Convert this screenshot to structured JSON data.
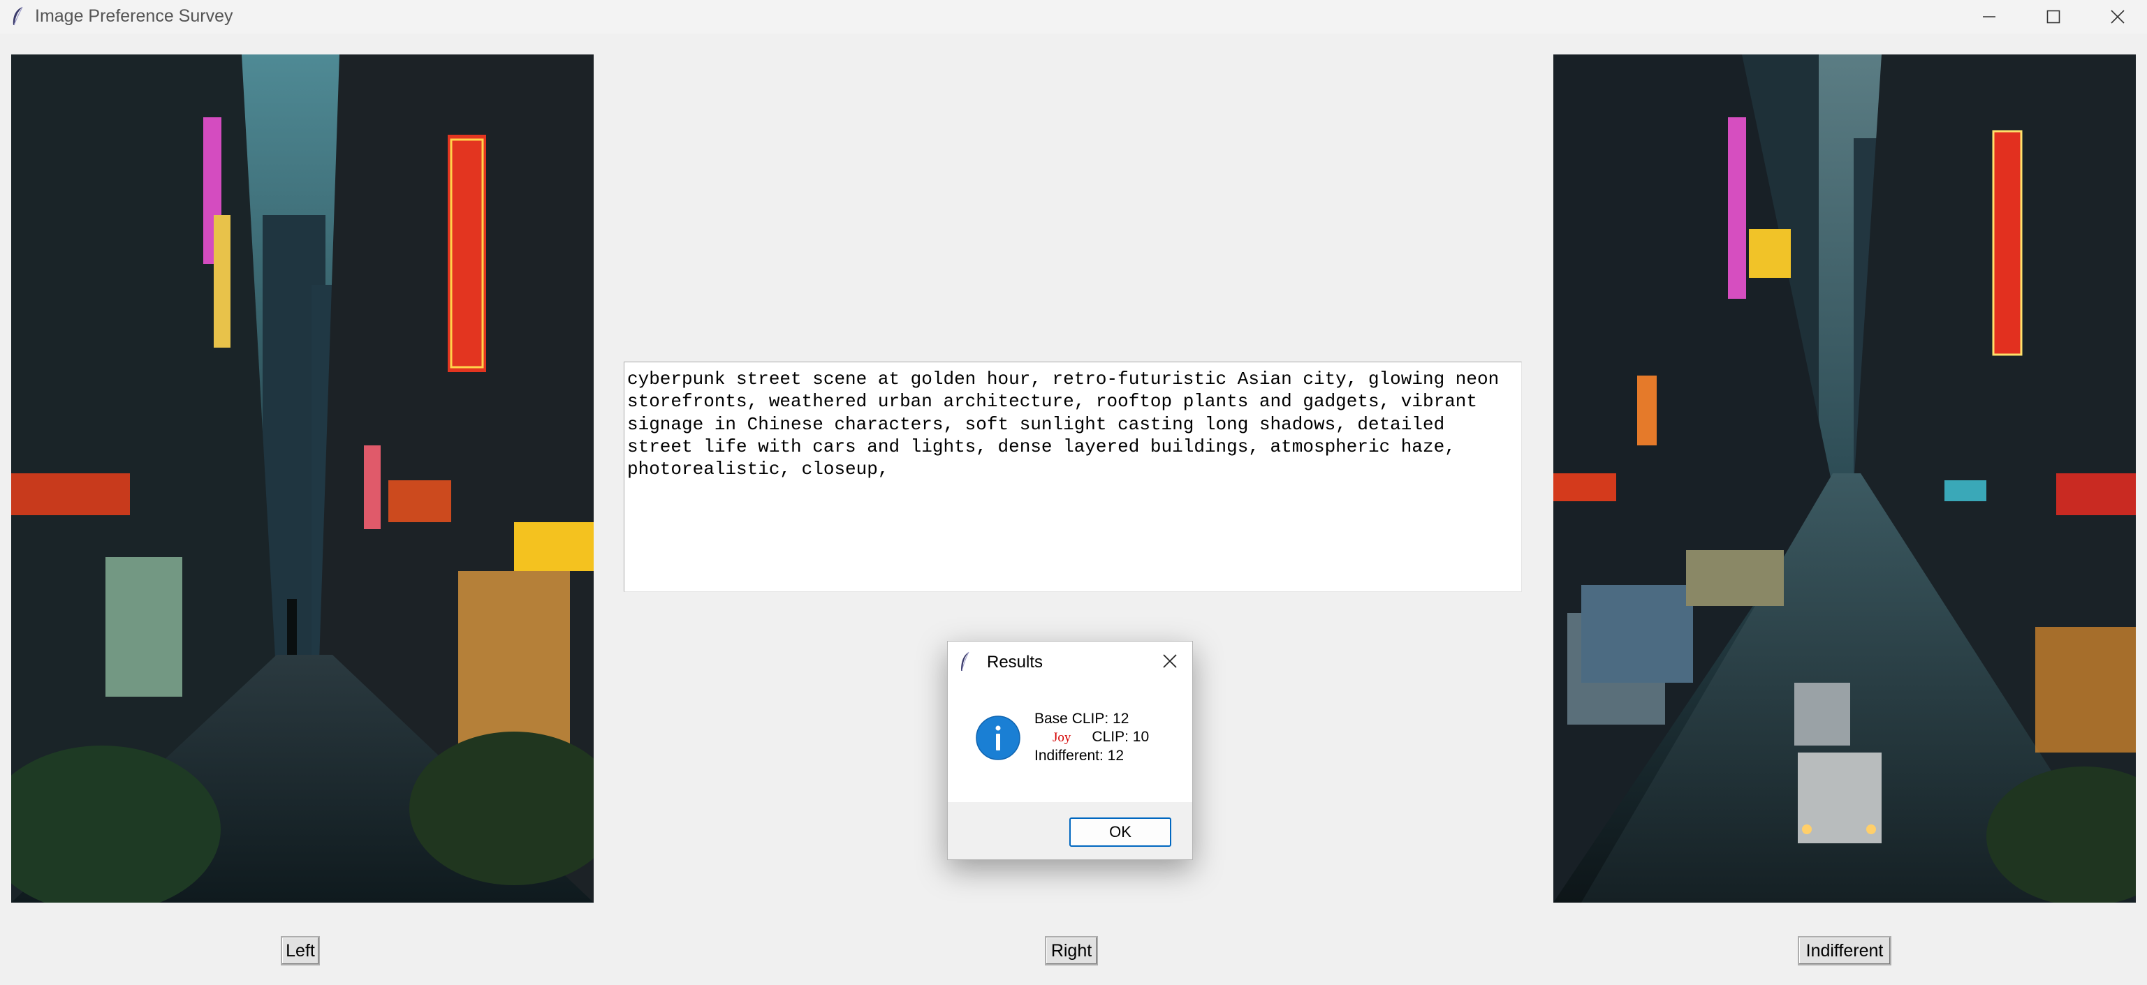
{
  "window": {
    "title": "Image Preference Survey",
    "icon": "feather-icon"
  },
  "prompt": {
    "text": "cyberpunk street scene at golden hour, retro-futuristic Asian city, glowing neon\nstorefronts, weathered urban architecture, rooftop plants and gadgets, vibrant\nsignage in Chinese characters, soft sunlight casting long shadows, detailed\nstreet life with cars and lights, dense layered buildings, atmospheric haze,\nphotorealistic, closeup,"
  },
  "buttons": {
    "left": "Left",
    "right": "Right",
    "indifferent": "Indifferent"
  },
  "dialog": {
    "title": "Results",
    "icon": "info-icon",
    "line1": "Base CLIP: 12",
    "joy_label": "Joy",
    "line2_rest": "CLIP: 10",
    "line3": "Indifferent: 12",
    "ok": "OK"
  },
  "colors": {
    "accent": "#0067c0",
    "info_icon": "#1a7fd4",
    "joy_text": "#d40000"
  }
}
